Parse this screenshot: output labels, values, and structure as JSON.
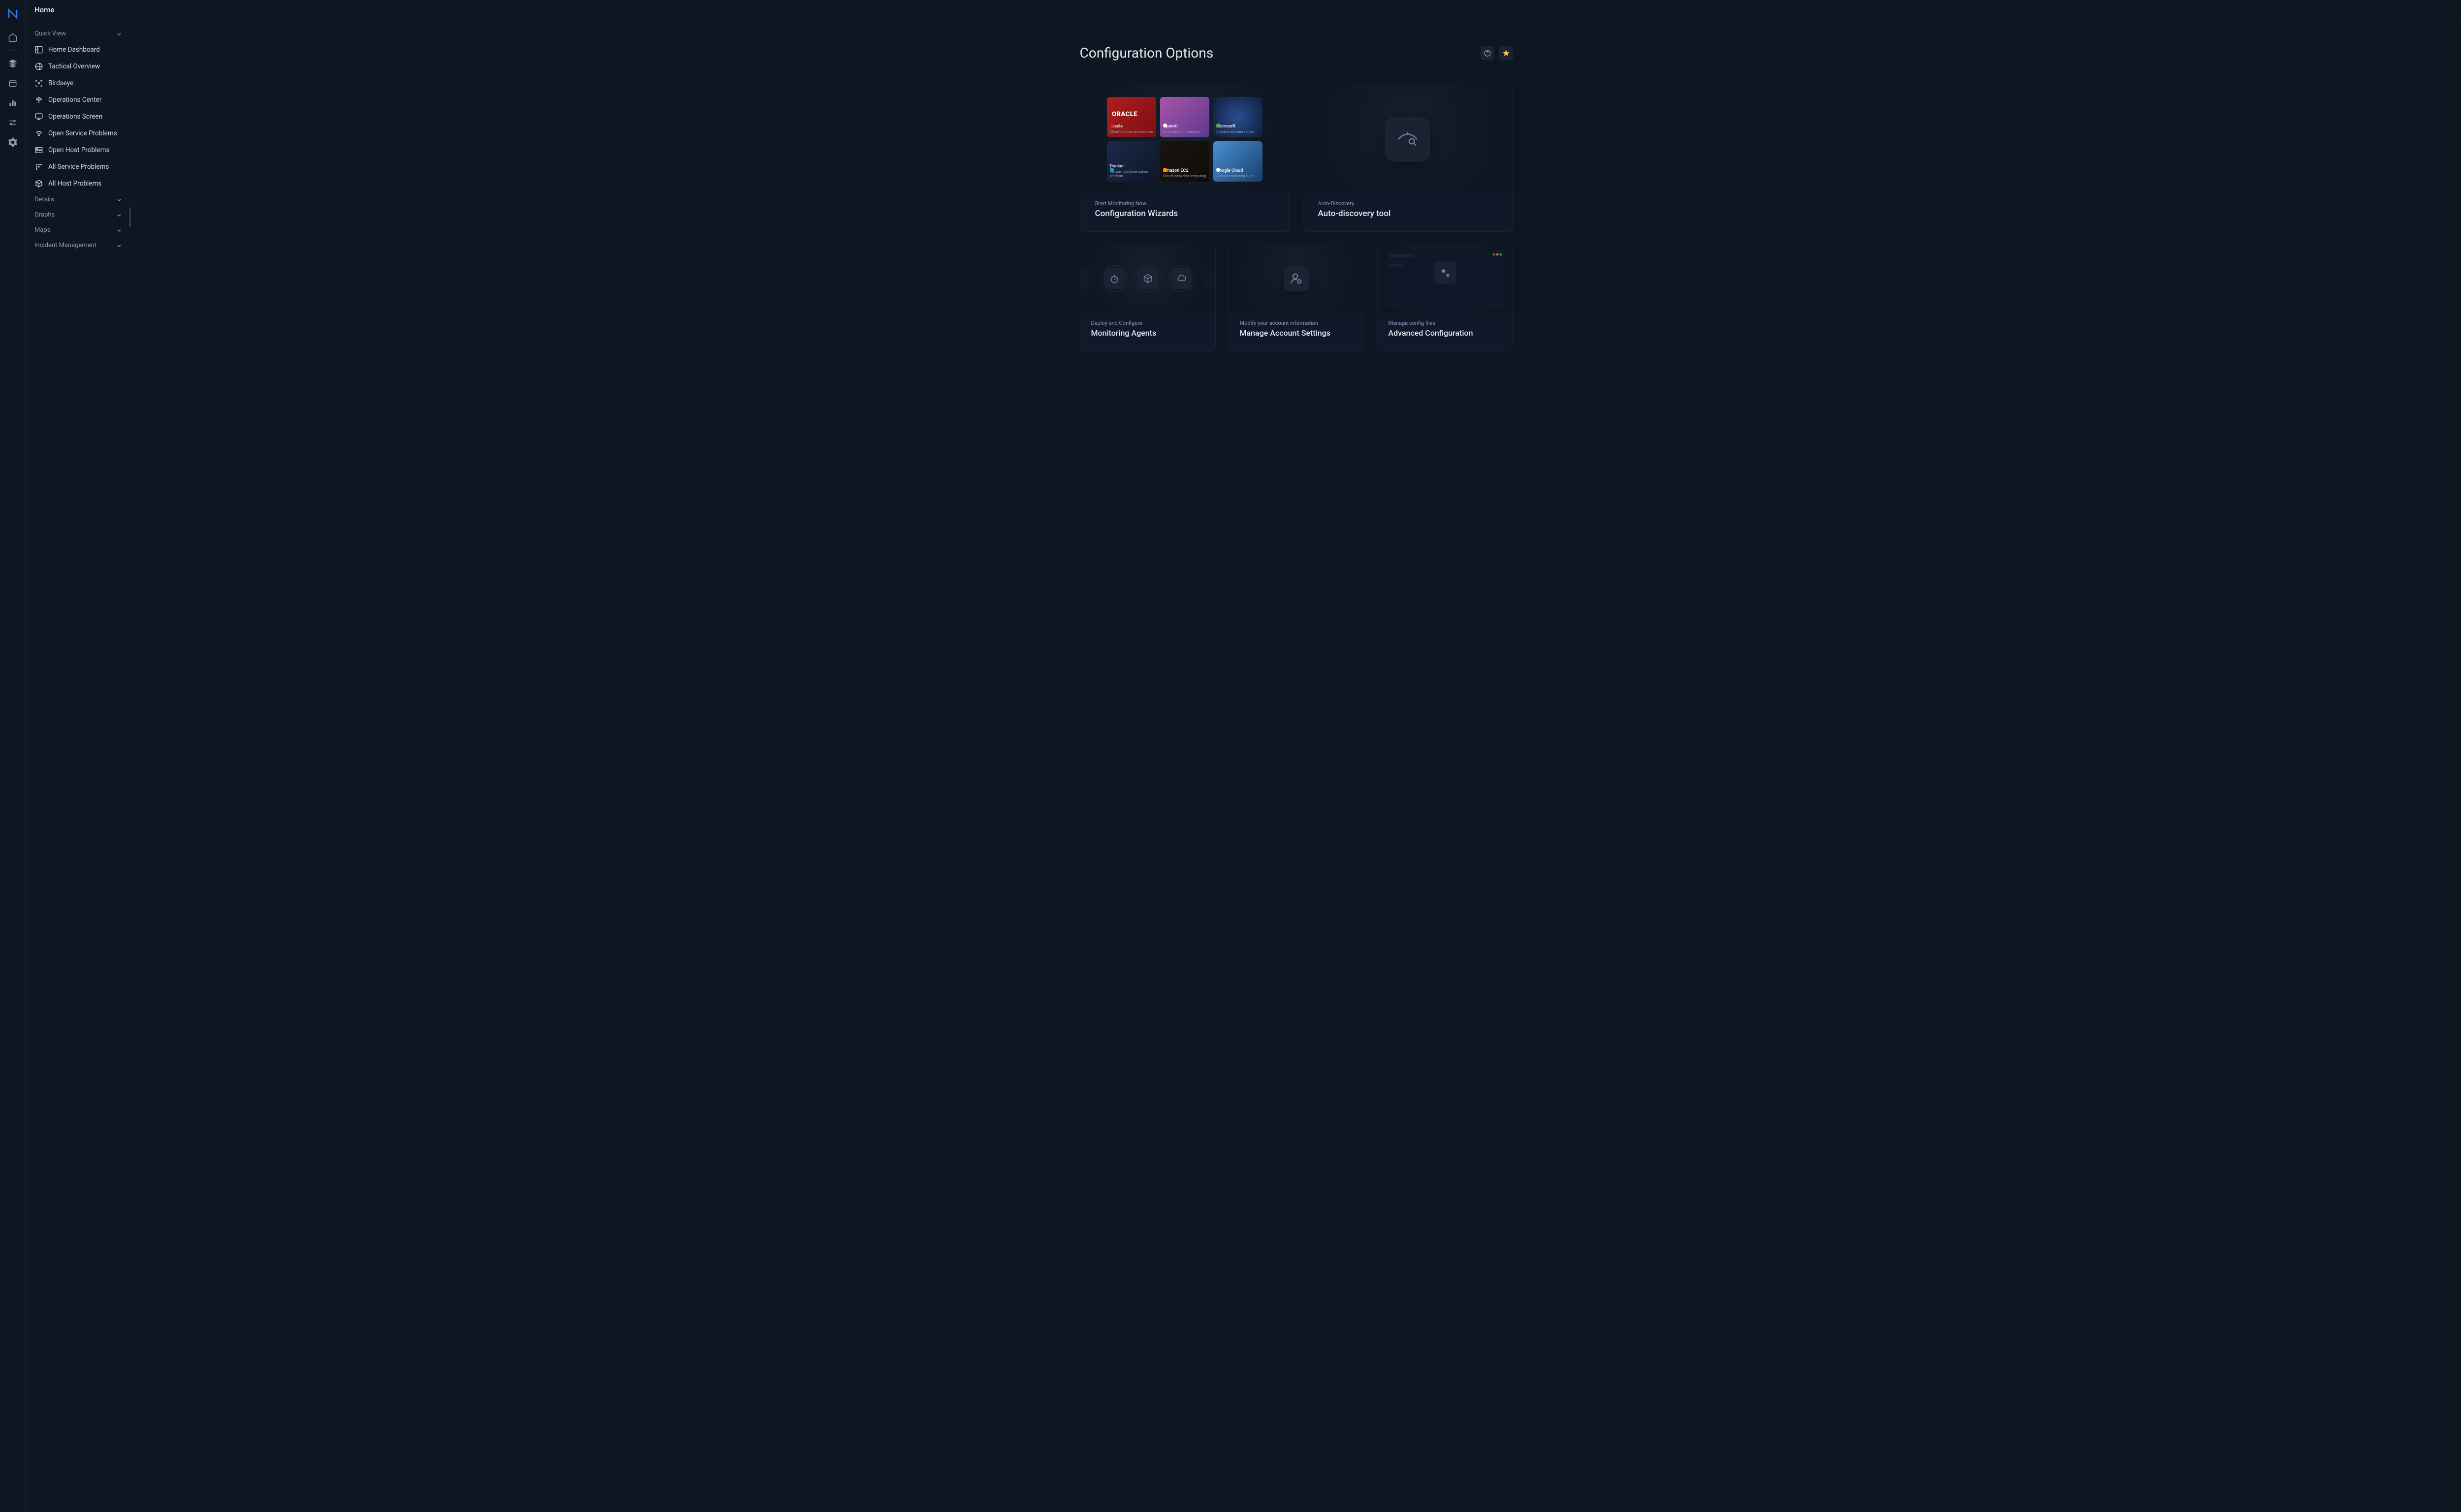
{
  "header": {
    "title": "Home"
  },
  "sidebar": {
    "sections": {
      "quick": "Quick View",
      "details": "Details",
      "graphs": "Graphs",
      "maps": "Maps",
      "incident": "Incident Management"
    },
    "items": [
      "Home Dashboard",
      "Tactical Overview",
      "Birdseye",
      "Operations Center",
      "Operations Screen",
      "Open Service Problems",
      "Open Host Problems",
      "All Service Problems",
      "All Host Problems"
    ]
  },
  "page": {
    "title": "Configuration Options"
  },
  "cards": {
    "wizards": {
      "kicker": "Start Monitoring Now",
      "title": "Configuration Wizards"
    },
    "autodisc": {
      "kicker": "Auto-Discovery",
      "title": "Auto-discovery tool"
    },
    "agents": {
      "kicker": "Deploy and Configure",
      "title": "Monitoring Agents"
    },
    "account": {
      "kicker": "Modify your account information",
      "title": "Manage Account Settings"
    },
    "advanced": {
      "kicker": "Manage config files",
      "title": "Advanced Configuration"
    }
  },
  "wizard_tiles": {
    "oracle": {
      "name": "Oracle",
      "desc": "Cloud platform and services",
      "logo": "ORACLE"
    },
    "openai": {
      "name": "OpenAI",
      "desc": "An AI research company"
    },
    "ms": {
      "name": "Microsoft",
      "desc": "A global software vendor"
    },
    "docker": {
      "name": "Docker",
      "desc": "An open containerization platform"
    },
    "ec2": {
      "name": "Amazon EC2",
      "desc": "Secure, resizable computing"
    },
    "gcloud": {
      "name": "Google Cloud",
      "desc": "A cloud computing suite"
    }
  }
}
